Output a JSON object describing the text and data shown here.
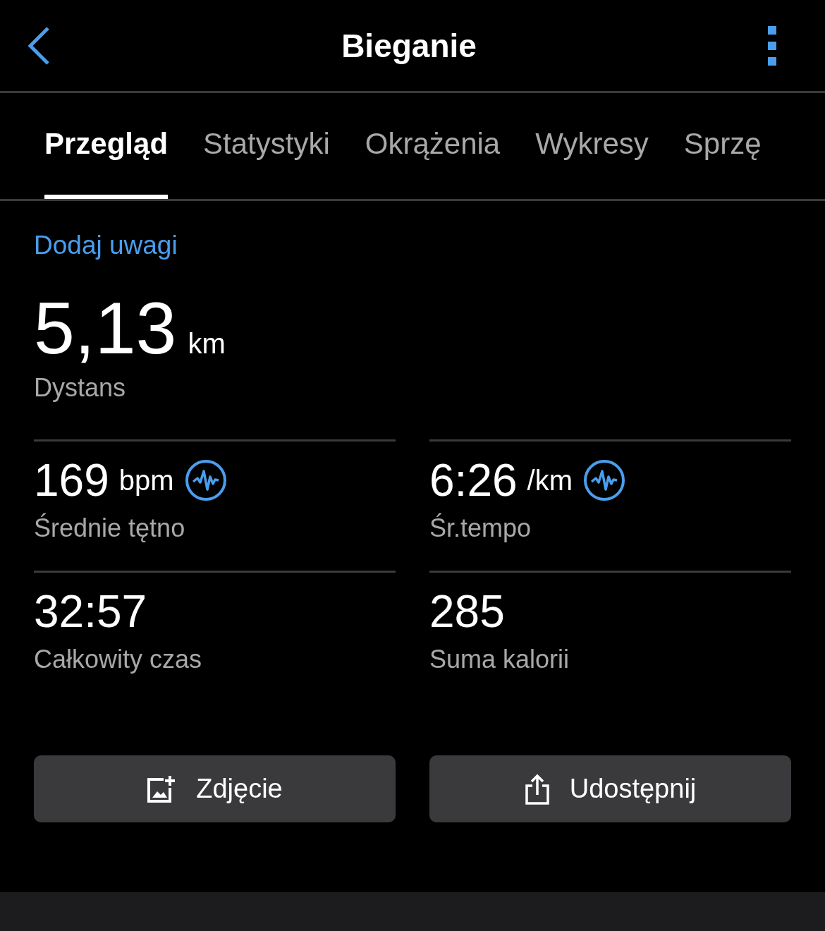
{
  "header": {
    "title": "Bieganie"
  },
  "tabs": [
    {
      "label": "Przegląd",
      "selected": true
    },
    {
      "label": "Statystyki",
      "selected": false
    },
    {
      "label": "Okrążenia",
      "selected": false
    },
    {
      "label": "Wykresy",
      "selected": false
    },
    {
      "label": "Sprzę",
      "selected": false
    }
  ],
  "notes_link": "Dodaj uwagi",
  "distance": {
    "value": "5,13",
    "unit": "km",
    "label": "Dystans"
  },
  "stats": [
    {
      "value": "169",
      "unit": "bpm",
      "label": "Średnie tętno",
      "chart_icon": true
    },
    {
      "value": "6:26",
      "unit": "/km",
      "label": "Śr.tempo",
      "chart_icon": true
    },
    {
      "value": "32:57",
      "label": "Całkowity czas",
      "chart_icon": false
    },
    {
      "value": "285",
      "label": "Suma kalorii",
      "chart_icon": false
    }
  ],
  "buttons": [
    {
      "kind": "photo",
      "label": "Zdjęcie"
    },
    {
      "kind": "share",
      "label": "Udostępnij"
    }
  ]
}
